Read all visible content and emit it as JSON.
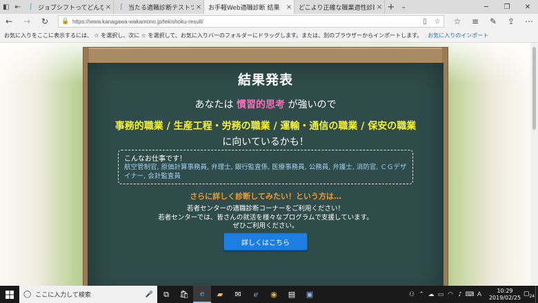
{
  "browser": {
    "tabs": [
      {
        "title": "ジョブシフトってどんなサイト？新"
      },
      {
        "title": "当たる適職診断テストツールまと"
      },
      {
        "title": "お手軽Web適職診断 結果"
      },
      {
        "title": "どこより正確な職業適性診断"
      }
    ],
    "new_tab_symbol": "+",
    "url": "https://www.kanagawa-wakamono.jp/tekishoku-result/",
    "favorites_hint": "お気に入りをここに表示するには、 ☆ を選択し、次に ☆ を選択して、お気に入りバーのフォルダーにドラッグします。または、別のブラウザーからインポートします。",
    "favorites_import_link": "お気に入りのインポート"
  },
  "result": {
    "title": "結果発表",
    "strong_prefix": "あなたは ",
    "strong_highlight": "慣習的思考",
    "strong_suffix": " が強いので",
    "jobs_highlight": "事務的職業 / 生産工程・労務の職業 / 運輸・通信の職業 / 保安の職業",
    "jobs_suffix": " に向いているかも！",
    "box_title": "こんなお仕事です！",
    "box_list": "航空管制官, 原価計算事務員, 弁理士, 銀行監査係, 医療事務員, 公務員, 弁護士, 消防官, ＣＧデザイナー, 会計監査員",
    "more_title": "さらに詳しく診断してみたい！という方は…",
    "intro_line1": "若者センターの適職診断コーナーをご利用ください！",
    "intro_line2": "若者センターでは、皆さんの就活を様々なプログラムで支援しています。",
    "intro_line3": "ぜひご利用ください。",
    "detail_button": "詳しくはこちら"
  },
  "taskbar": {
    "search_placeholder": "ここに入力して検索",
    "time": "10:29",
    "date": "2019/02/25",
    "notification_count": "24"
  }
}
